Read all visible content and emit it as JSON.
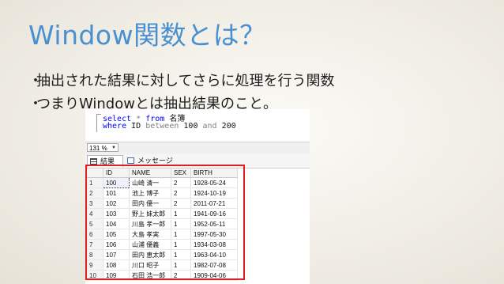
{
  "slide": {
    "title": "Window関数とは？",
    "bullets": [
      "抽出された結果に対してさらに処理を行う関数",
      "つまりWindowとは抽出結果のこと。"
    ],
    "bullet_mark": "・"
  },
  "editor": {
    "line1": {
      "kw_select": "select",
      "star": "*",
      "kw_from": "from",
      "table": "名簿"
    },
    "line2": {
      "kw_where": "where",
      "col": "ID",
      "kw_between": "between",
      "lo": "100",
      "kw_and": "and",
      "hi": "200"
    }
  },
  "zoom": {
    "value": "131 %"
  },
  "tabs": {
    "results": "結果",
    "messages": "メッセージ"
  },
  "grid": {
    "columns": [
      "ID",
      "NAME",
      "SEX",
      "BIRTH"
    ],
    "rows": [
      {
        "num": "1",
        "id": "100",
        "name": "山崎 清一",
        "sex": "2",
        "birth": "1928-05-24"
      },
      {
        "num": "2",
        "id": "101",
        "name": "池上 博子",
        "sex": "2",
        "birth": "1924-10-19"
      },
      {
        "num": "3",
        "id": "102",
        "name": "田内 優一",
        "sex": "2",
        "birth": "2011-07-21"
      },
      {
        "num": "4",
        "id": "103",
        "name": "野上 妹太郎",
        "sex": "1",
        "birth": "1941-09-16"
      },
      {
        "num": "5",
        "id": "104",
        "name": "川島 孝一郎",
        "sex": "1",
        "birth": "1952-05-11"
      },
      {
        "num": "6",
        "id": "105",
        "name": "大島 孝実",
        "sex": "1",
        "birth": "1997-05-30"
      },
      {
        "num": "7",
        "id": "106",
        "name": "山浦 優義",
        "sex": "1",
        "birth": "1934-03-08"
      },
      {
        "num": "8",
        "id": "107",
        "name": "田内 恵太郎",
        "sex": "1",
        "birth": "1963-04-10"
      },
      {
        "num": "9",
        "id": "108",
        "name": "川口 昭子",
        "sex": "1",
        "birth": "1982-07-08"
      },
      {
        "num": "10",
        "id": "109",
        "name": "石田 浩一郎",
        "sex": "2",
        "birth": "1909-04-06"
      }
    ]
  },
  "colors": {
    "title": "#4a8fd0",
    "highlight_box": "#e02020",
    "keyword": "#0000ff"
  }
}
